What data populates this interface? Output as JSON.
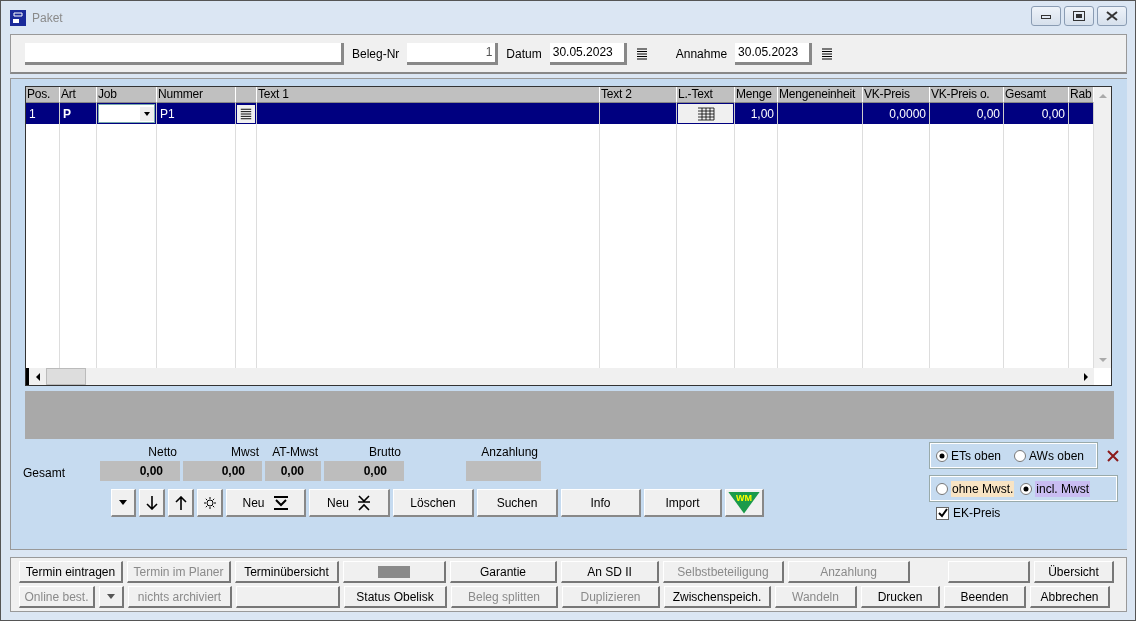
{
  "window": {
    "title": "Paket"
  },
  "header": {
    "fields": [
      {
        "kind": "text"
      },
      {
        "kind": "number",
        "label": "Beleg-Nr",
        "value": "1"
      },
      {
        "kind": "date",
        "label": "Datum",
        "value": "30.05.2023"
      },
      {
        "kind": "date",
        "label": "Annahme",
        "value": "30.05.2023"
      }
    ]
  },
  "table": {
    "columns": [
      "Pos.",
      "Art",
      "Job",
      "Nummer",
      "",
      "Text 1",
      "Text 2",
      "L.-Text",
      "Menge",
      "Mengeneinheit",
      "VK-Preis",
      "VK-Preis o.",
      "Gesamt",
      "Rab"
    ],
    "rows": [
      {
        "selected": true,
        "cells": [
          "1",
          "P",
          "",
          "P1",
          "",
          "",
          "",
          "",
          "1,00",
          "",
          "0,0000",
          "0,00",
          "0,00",
          ""
        ]
      }
    ]
  },
  "totals": {
    "label": "Gesamt",
    "items": [
      {
        "label": "Netto",
        "value": "0,00"
      },
      {
        "label": "Mwst",
        "value": "0,00"
      },
      {
        "label": "AT-Mwst",
        "value": "0,00"
      },
      {
        "label": "Brutto",
        "value": "0,00"
      },
      {
        "label": "Anzahlung",
        "value": ""
      }
    ]
  },
  "actions": [
    {
      "kind": "dropdown"
    },
    {
      "kind": "down"
    },
    {
      "kind": "up"
    },
    {
      "kind": "gear"
    },
    {
      "kind": "new-below",
      "label": "Neu"
    },
    {
      "kind": "new-between",
      "label": "Neu"
    },
    {
      "kind": "text",
      "label": "Löschen"
    },
    {
      "kind": "text",
      "label": "Suchen"
    },
    {
      "kind": "text",
      "label": "Info"
    },
    {
      "kind": "text",
      "label": "Import"
    },
    {
      "kind": "logo",
      "label": "WM"
    }
  ],
  "order_options": [
    {
      "label": "ETs oben",
      "selected": true
    },
    {
      "label": "AWs oben",
      "selected": false
    }
  ],
  "tax_options": [
    {
      "label": "ohne Mwst.",
      "selected": false,
      "color": "#f8e4c4"
    },
    {
      "label": "incl. Mwst",
      "selected": true,
      "color": "#c9bdf2"
    }
  ],
  "ek_preis": {
    "label": "EK-Preis",
    "checked": true
  },
  "bottom_buttons": [
    [
      {
        "kind": "button",
        "label": "Termin eintragen",
        "disabled": false
      },
      {
        "kind": "button",
        "label": "Termin im Planer",
        "disabled": true
      },
      {
        "kind": "button",
        "label": "Terminübersicht",
        "disabled": false
      },
      {
        "kind": "blurred"
      },
      {
        "kind": "button",
        "label": "Garantie",
        "disabled": false
      },
      {
        "kind": "button",
        "label": "An SD II",
        "disabled": false
      },
      {
        "kind": "button",
        "label": "Selbstbeteiligung",
        "disabled": true
      },
      {
        "kind": "button",
        "label": "Anzahlung",
        "disabled": true
      },
      {
        "kind": "gap"
      },
      {
        "kind": "blank"
      },
      {
        "kind": "button",
        "label": "Übersicht",
        "disabled": false
      }
    ],
    [
      {
        "kind": "button",
        "label": "Online best.",
        "disabled": true
      },
      {
        "kind": "dropdown"
      },
      {
        "kind": "button",
        "label": "nichts archiviert",
        "disabled": true
      },
      {
        "kind": "blank"
      },
      {
        "kind": "button",
        "label": "Status Obelisk",
        "disabled": false
      },
      {
        "kind": "button",
        "label": "Beleg splitten",
        "disabled": true
      },
      {
        "kind": "button",
        "label": "Duplizieren",
        "disabled": true
      },
      {
        "kind": "button",
        "label": "Zwischenspeich.",
        "disabled": false
      },
      {
        "kind": "button",
        "label": "Wandeln",
        "disabled": true
      },
      {
        "kind": "button",
        "label": "Drucken",
        "disabled": false
      },
      {
        "kind": "button",
        "label": "Beenden",
        "disabled": false
      },
      {
        "kind": "button",
        "label": "Abbrechen",
        "disabled": false
      }
    ]
  ]
}
